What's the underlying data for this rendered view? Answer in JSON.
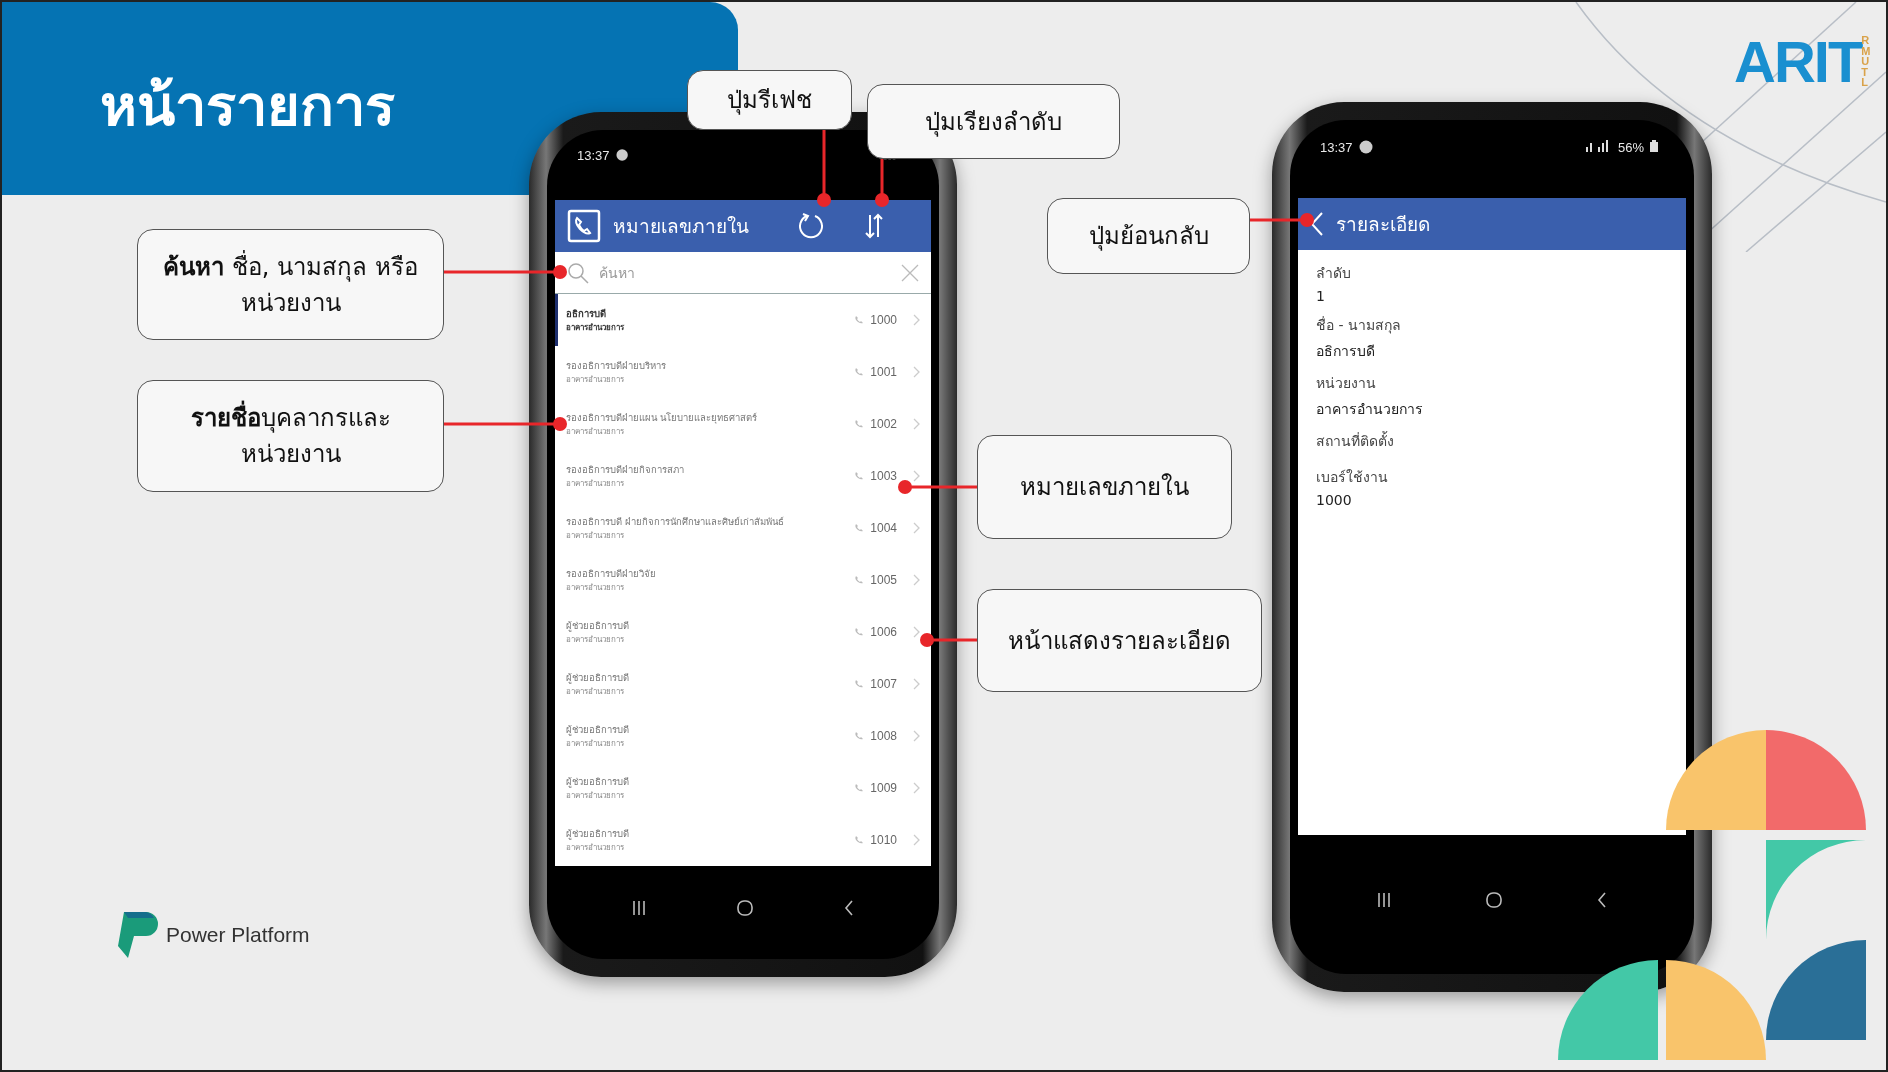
{
  "slide": {
    "title": "หน้ารายการ"
  },
  "callouts": [
    {
      "text": "ปุ่มรีเฟช"
    },
    {
      "text": "ปุ่มเรียงลำดับ"
    },
    {
      "text": "ปุ่มย้อนกลับ"
    },
    {
      "text": "**ค้นหา** ชื่อ, นามสกุล หรือหน่วยงาน"
    },
    {
      "text": "**รายชื่อ**บุคลากรและหน่วยงาน"
    },
    {
      "text": "หมายเลขภายใน"
    },
    {
      "text": "หน้าแสดงรายละเอียด"
    }
  ],
  "list_screen": {
    "status_time": "13:37",
    "app_title": "หมายเลขภายใน",
    "search": {
      "placeholder": "ค้นหา"
    },
    "rows": [
      {
        "title": "อธิการบดี",
        "subtitle": "อาคารอำนวยการ",
        "extension": "1000",
        "selected": true
      },
      {
        "title": "รองอธิการบดีฝ่ายบริหาร",
        "subtitle": "อาคารอำนวยการ",
        "extension": "1001",
        "selected": false
      },
      {
        "title": "รองอธิการบดีฝ่ายแผน นโยบายและยุทธศาสตร์",
        "subtitle": "อาคารอำนวยการ",
        "extension": "1002",
        "selected": false
      },
      {
        "title": "รองอธิการบดีฝ่ายกิจการสภา",
        "subtitle": "อาคารอำนวยการ",
        "extension": "1003",
        "selected": false
      },
      {
        "title": "รองอธิการบดี ฝ่ายกิจการนักศึกษาและศิษย์เก่าสัมพันธ์",
        "subtitle": "อาคารอำนวยการ",
        "extension": "1004",
        "selected": false
      },
      {
        "title": "รองอธิการบดีฝ่ายวิจัย",
        "subtitle": "อาคารอำนวยการ",
        "extension": "1005",
        "selected": false
      },
      {
        "title": "ผู้ช่วยอธิการบดี",
        "subtitle": "อาคารอำนวยการ",
        "extension": "1006",
        "selected": false
      },
      {
        "title": "ผู้ช่วยอธิการบดี",
        "subtitle": "อาคารอำนวยการ",
        "extension": "1007",
        "selected": false
      },
      {
        "title": "ผู้ช่วยอธิการบดี",
        "subtitle": "อาคารอำนวยการ",
        "extension": "1008",
        "selected": false
      },
      {
        "title": "ผู้ช่วยอธิการบดี",
        "subtitle": "อาคารอำนวยการ",
        "extension": "1009",
        "selected": false
      },
      {
        "title": "ผู้ช่วยอธิการบดี",
        "subtitle": "อาคารอำนวยการ",
        "extension": "1010",
        "selected": false
      }
    ]
  },
  "detail_screen": {
    "status_time": "13:37",
    "battery": "56%",
    "title": "รายละเอียด",
    "fields": [
      {
        "label": "ลำดับ",
        "value": "1"
      },
      {
        "label": "ชื่อ - นามสกุล",
        "value": "อธิการบดี"
      },
      {
        "label": "หน่วยงาน",
        "value": "อาคารอำนวยการ"
      },
      {
        "label": "สถานที่ติดตั้ง"
      },
      {
        "label": "เบอร์ใช้งาน",
        "value": "1000"
      }
    ]
  },
  "brand_logo": {
    "letters": "ARIT",
    "sub": "RMUTL"
  },
  "footer_logo": {
    "text": "Power Platform"
  }
}
